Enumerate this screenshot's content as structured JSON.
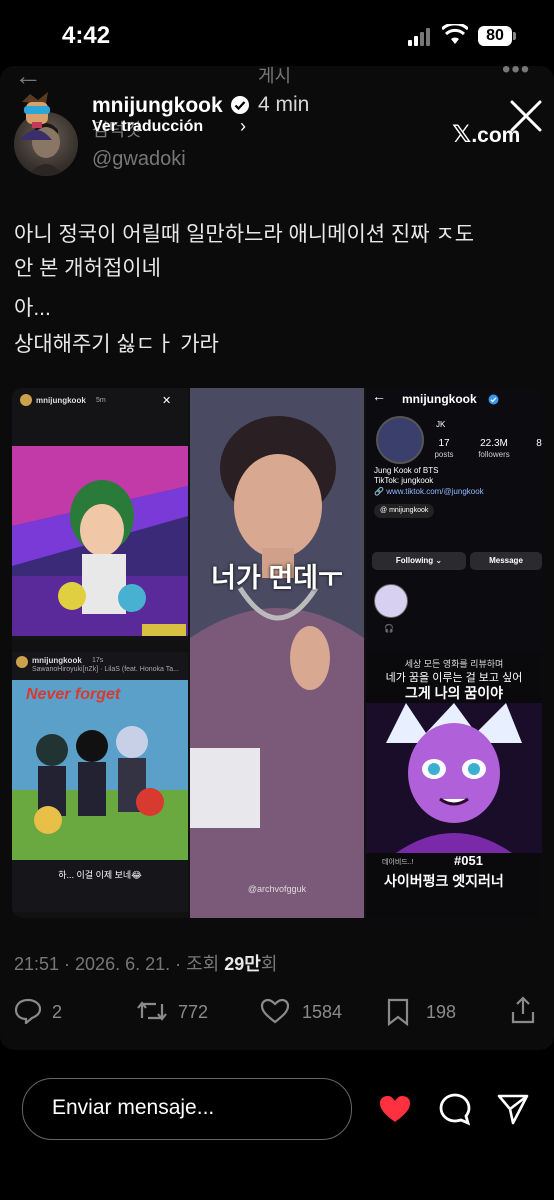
{
  "status_bar": {
    "time": "4:42",
    "battery": "80"
  },
  "header": {
    "title": "게시"
  },
  "post": {
    "username": "mnijungkook",
    "time_ago": "4 min",
    "translate_label": "Ver traducción",
    "display_name": "김덕갓",
    "handle": "@gwadoki",
    "source_label": ".com",
    "lines": [
      "아니 정국이 어릴때 일만하느라 애니메이션 진짜 ㅈ도",
      "안 본 개허접이네",
      "아...",
      "상대해주기 싫ㄷㅏ 가라"
    ],
    "collage": {
      "panel1_user": "mnijungkook",
      "panel1_time": "5m",
      "panel2_user": "mnijungkook",
      "panel2_time": "17s",
      "panel2_music": "SawanoHiroyuki[nZk] · LilaS (feat. Honoka Ta...",
      "panel2_overlay": "Never forget",
      "panel2_caption": "하... 이걸 이제 보네😂",
      "center_overlay": "너가 먼데ㅜ",
      "center_credit": "@archvofgguk",
      "profile_user": "mnijungkook",
      "profile_initials": "JK",
      "posts_count": "17",
      "posts_label": "posts",
      "followers_count": "22.3M",
      "followers_label": "followers",
      "following_count": "8",
      "bio_name": "Jung Kook of BTS",
      "bio_tiktok": "TikTok: jungkook",
      "bio_link": "www.tiktok.com/@jungkook",
      "threads_handle": "mnijungkook",
      "following_btn": "Following",
      "message_btn": "Message",
      "review_line1": "세상 모든 영화를 리뷰하며",
      "review_line2": "네가 꿈을 이루는 걸 보고 싶어",
      "review_line3": "그게 나의 꿈이야",
      "review_tag": "데이비드..!",
      "review_number": "#051",
      "review_title": "사이버펑크 엣지러너"
    },
    "timestamp": "21:51 · 2026. 6. 21. · 조회",
    "views": "29만",
    "views_suffix": "회",
    "replies": "2",
    "reposts": "772",
    "likes": "1584",
    "bookmarks": "198"
  },
  "bottom_bar": {
    "message_placeholder": "Enviar mensaje..."
  },
  "colors": {
    "like_red": "#ff3040",
    "background": "#000000",
    "muted_gray": "#777777"
  }
}
